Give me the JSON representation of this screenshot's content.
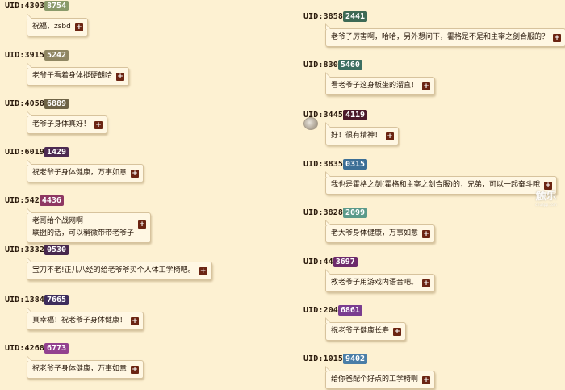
{
  "left": [
    {
      "uid": "UID:4303",
      "badge": "8754",
      "color": "#8a9a6a",
      "lines": [
        "祝福，zsbd"
      ]
    },
    {
      "uid": "UID:3915",
      "badge": "5242",
      "color": "#8f8662",
      "lines": [
        "老爷子看着身体挺硬朗哈"
      ]
    },
    {
      "uid": "UID:4058",
      "badge": "6889",
      "color": "#6e6346",
      "lines": [
        "老爷子身体真好！"
      ]
    },
    {
      "uid": "UID:6019",
      "badge": "1429",
      "color": "#4c2a52",
      "lines": [
        "祝老爷子身体健康，万事如意"
      ]
    },
    {
      "uid": "UID:542",
      "badge": "4436",
      "color": "#8e3762",
      "lines": [
        "老哥给个战网啊",
        "联盟的话，可以稍微带带老爷子"
      ]
    },
    {
      "uid": "UID:3332",
      "badge": "0530",
      "color": "#47284d",
      "lines": [
        "宝刀不老!正儿八经的给老爷爷买个人体工学椅吧。"
      ]
    },
    {
      "uid": "UID:1384",
      "badge": "7665",
      "color": "#3e2d5c",
      "lines": [
        "真幸福！祝老爷子身体健康！"
      ]
    },
    {
      "uid": "UID:4268",
      "badge": "6773",
      "color": "#93418f",
      "lines": [
        "祝老爷子身体健康，万事如意"
      ]
    }
  ],
  "right": [
    {
      "uid": "UID:3858",
      "badge": "2441",
      "color": "#3e6a55",
      "lines": [
        "老爷子厉害啊，哈哈，另外想问下，霍格是不是和主宰之剑合服的？"
      ]
    },
    {
      "uid": "UID:830",
      "badge": "5460",
      "color": "#3c6e61",
      "lines": [
        "看老爷子这身板坐的溜直！"
      ]
    },
    {
      "uid": "UID:3445",
      "badge": "4119",
      "color": "#4b1a2a",
      "lines": [
        "好！很有精神！"
      ]
    },
    {
      "uid": "UID:3835",
      "badge": "0315",
      "color": "#3c6f96",
      "lines": [
        "我也是霍格之剑(霍格和主宰之剑合服)的，兄弟，可以一起奋斗哦"
      ]
    },
    {
      "uid": "UID:3828",
      "badge": "2099",
      "color": "#5b9a8a",
      "lines": [
        "老大爷身体健康，万事如意"
      ]
    },
    {
      "uid": "UID:44",
      "badge": "3697",
      "color": "#6d2a6b",
      "lines": [
        "教老爷子用游戏内语音吧。"
      ]
    },
    {
      "uid": "UID:204",
      "badge": "6861",
      "color": "#7a3d8f",
      "lines": [
        "祝老爷子健康长寿"
      ]
    },
    {
      "uid": "UID:1015",
      "badge": "9402",
      "color": "#4a7ea7",
      "lines": [
        "给你爸配个好点的工学椅啊"
      ]
    }
  ],
  "watermark": {
    "title": "触乐",
    "sub": "chuapp.com"
  }
}
